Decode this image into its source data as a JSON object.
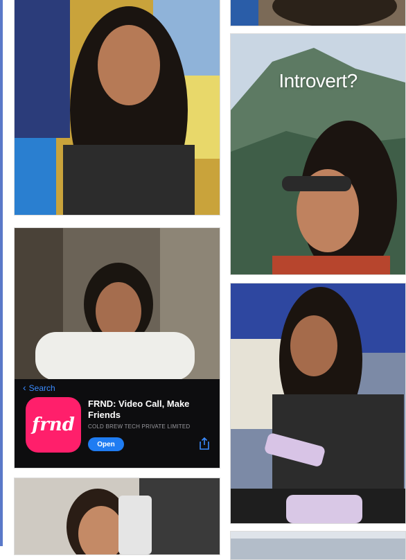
{
  "tiles": {
    "introvert": {
      "overlay_text": "Introvert?"
    },
    "frnd": {
      "back_label": "Search",
      "app_icon_text": "frnd",
      "app_name": "FRND: Video Call, Make Friends",
      "developer": "COLD BREW TECH PRIVATE LIMITED",
      "open_label": "Open"
    }
  },
  "colors": {
    "edge_bar": "#5a79c9",
    "app_icon": "#ff1f6b",
    "open_button": "#1f7cf2",
    "link": "#3a8bff"
  }
}
